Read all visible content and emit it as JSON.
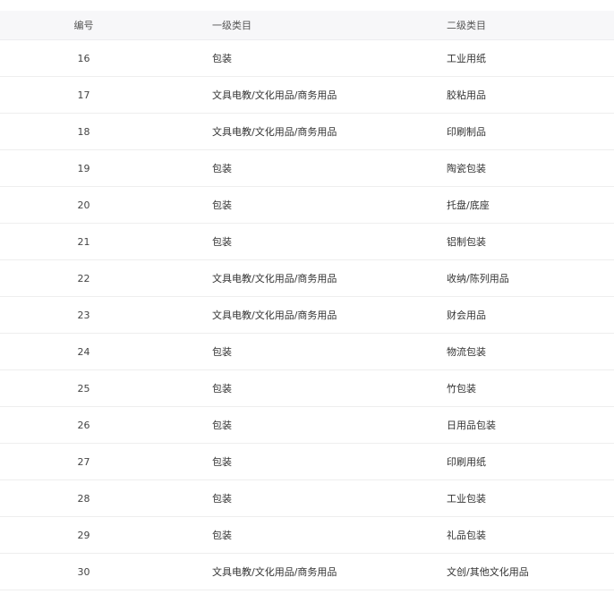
{
  "table": {
    "headers": {
      "id": "编号",
      "category_1": "一级类目",
      "category_2": "二级类目"
    },
    "rows": [
      {
        "id": "16",
        "category_1": "包装",
        "category_2": "工业用纸"
      },
      {
        "id": "17",
        "category_1": "文具电教/文化用品/商务用品",
        "category_2": "胶粘用品"
      },
      {
        "id": "18",
        "category_1": "文具电教/文化用品/商务用品",
        "category_2": "印刷制品"
      },
      {
        "id": "19",
        "category_1": "包装",
        "category_2": "陶瓷包装"
      },
      {
        "id": "20",
        "category_1": "包装",
        "category_2": "托盘/底座"
      },
      {
        "id": "21",
        "category_1": "包装",
        "category_2": "铝制包装"
      },
      {
        "id": "22",
        "category_1": "文具电教/文化用品/商务用品",
        "category_2": "收纳/陈列用品"
      },
      {
        "id": "23",
        "category_1": "文具电教/文化用品/商务用品",
        "category_2": "财会用品"
      },
      {
        "id": "24",
        "category_1": "包装",
        "category_2": "物流包装"
      },
      {
        "id": "25",
        "category_1": "包装",
        "category_2": "竹包装"
      },
      {
        "id": "26",
        "category_1": "包装",
        "category_2": "日用品包装"
      },
      {
        "id": "27",
        "category_1": "包装",
        "category_2": "印刷用纸"
      },
      {
        "id": "28",
        "category_1": "包装",
        "category_2": "工业包装"
      },
      {
        "id": "29",
        "category_1": "包装",
        "category_2": "礼品包装"
      },
      {
        "id": "30",
        "category_1": "文具电教/文化用品/商务用品",
        "category_2": "文创/其他文化用品"
      }
    ]
  }
}
